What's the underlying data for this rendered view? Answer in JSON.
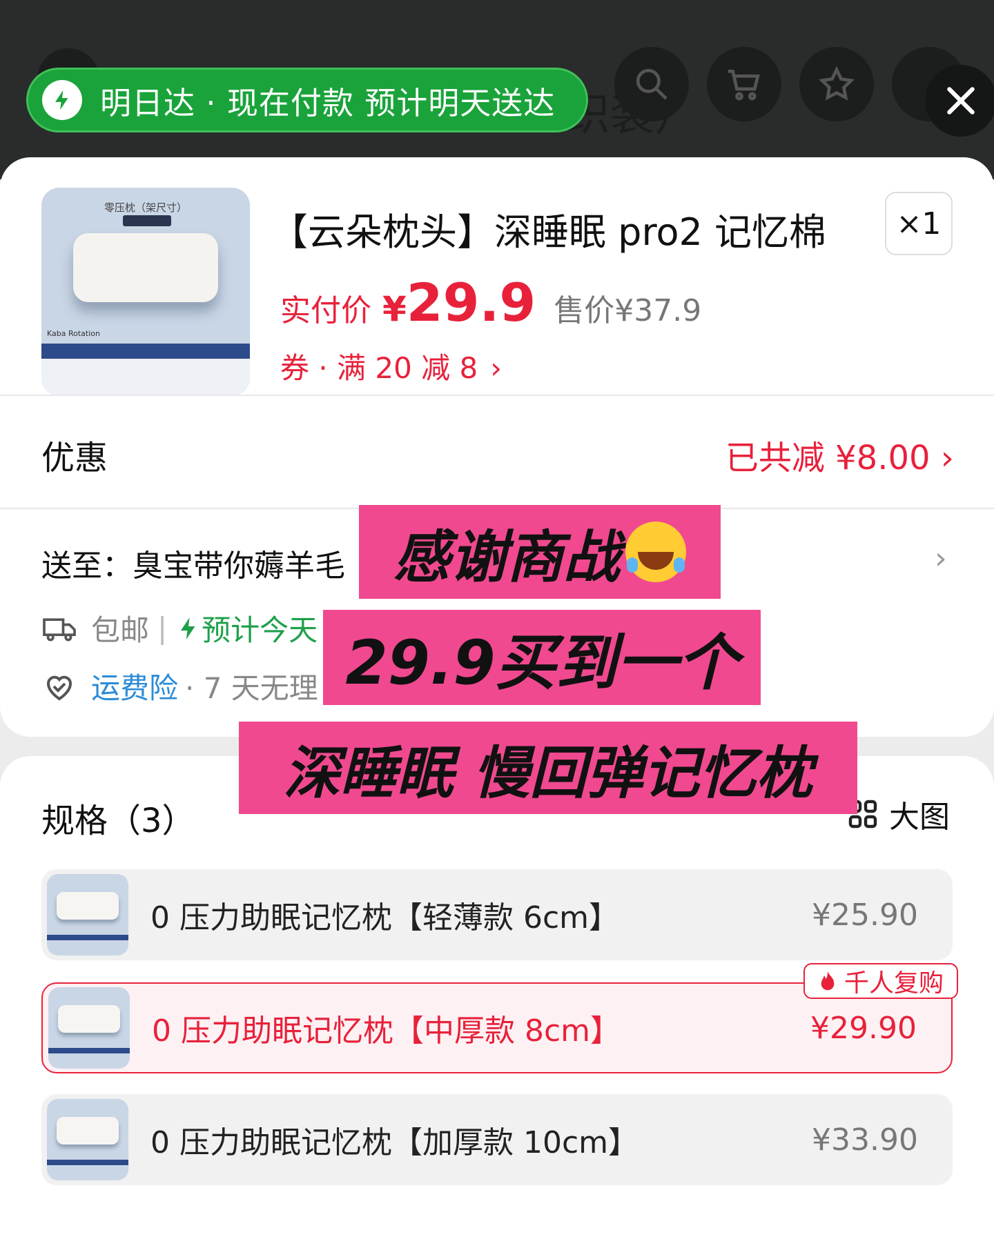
{
  "header": {
    "ghost_title": "织装）",
    "delivery_text": "明日达 · 现在付款 预计明天送达"
  },
  "product": {
    "title": "【云朵枕头】深睡眠 pro2 记忆棉",
    "qty": "×1",
    "pay_label": "实付价",
    "currency": "¥",
    "pay_price": "29.9",
    "original_price": "售价¥37.9",
    "coupon": "券 · 满 20 减 8",
    "coupon_chevron": "›",
    "image_text": {
      "top": "零压枕（架尺寸）",
      "caption": "Kaba Rotation"
    }
  },
  "discount": {
    "label": "优惠",
    "value": "已共减 ¥8.00 ›"
  },
  "shipping": {
    "ship_to": "送至：臭宝带你薅羊毛",
    "chevron": "›",
    "free_ship": "包邮",
    "separator": "|",
    "eta": "预计今天",
    "insurance": "运费险",
    "insurance_note": "· 7 天无理"
  },
  "specs": {
    "title": "规格（3）",
    "big_view": "大图",
    "badge": "千人复购",
    "options": [
      {
        "name": "0 压力助眠记忆枕【轻薄款 6cm】",
        "price": "¥25.90"
      },
      {
        "name": "0 压力助眠记忆枕【中厚款 8cm】",
        "price": "¥29.90"
      },
      {
        "name": "0 压力助眠记忆枕【加厚款 10cm】",
        "price": "¥33.90"
      }
    ]
  },
  "overlay": {
    "line1": "感谢商战",
    "line2": "29.9买到一个",
    "line3": "深睡眠 慢回弹记忆枕"
  },
  "colors": {
    "accent_red": "#e8213b",
    "delivery_green": "#1aa33a",
    "banner_pink": "#f0498f",
    "insurance_blue": "#2b8bd6"
  },
  "icons": [
    "lightning-icon",
    "search-icon",
    "cart-icon",
    "star-icon",
    "close-icon",
    "truck-icon",
    "heart-shield-icon",
    "grid-icon",
    "flame-icon",
    "laugh-cry-emoji"
  ]
}
